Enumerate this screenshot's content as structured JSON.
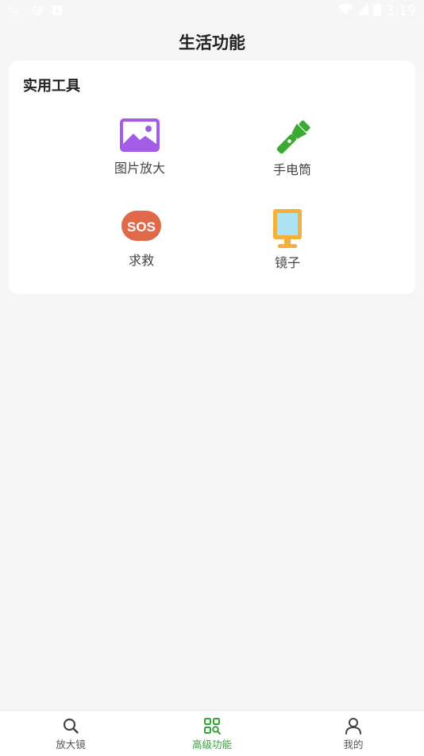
{
  "status_bar": {
    "left_text": "Top",
    "time": "3:19",
    "icons": [
      "target-icon",
      "notification-icon",
      "wifi-icon",
      "signal-icon",
      "battery-icon"
    ]
  },
  "header": {
    "title": "生活功能"
  },
  "section": {
    "title": "实用工具",
    "tools": [
      {
        "label": "图片放大",
        "icon": "image-icon",
        "color": "#a35ce6"
      },
      {
        "label": "手电筒",
        "icon": "flashlight-icon",
        "color": "#3aaa35"
      },
      {
        "label": "求救",
        "icon": "sos-icon",
        "color": "#e0694a",
        "icon_text": "SOS"
      },
      {
        "label": "镜子",
        "icon": "mirror-icon",
        "color": "#f2b13a"
      }
    ]
  },
  "bottom_nav": {
    "items": [
      {
        "label": "放大镜",
        "icon": "search-icon",
        "active": false
      },
      {
        "label": "高级功能",
        "icon": "grid-search-icon",
        "active": true
      },
      {
        "label": "我的",
        "icon": "user-icon",
        "active": false
      }
    ],
    "active_color": "#33a33a"
  }
}
